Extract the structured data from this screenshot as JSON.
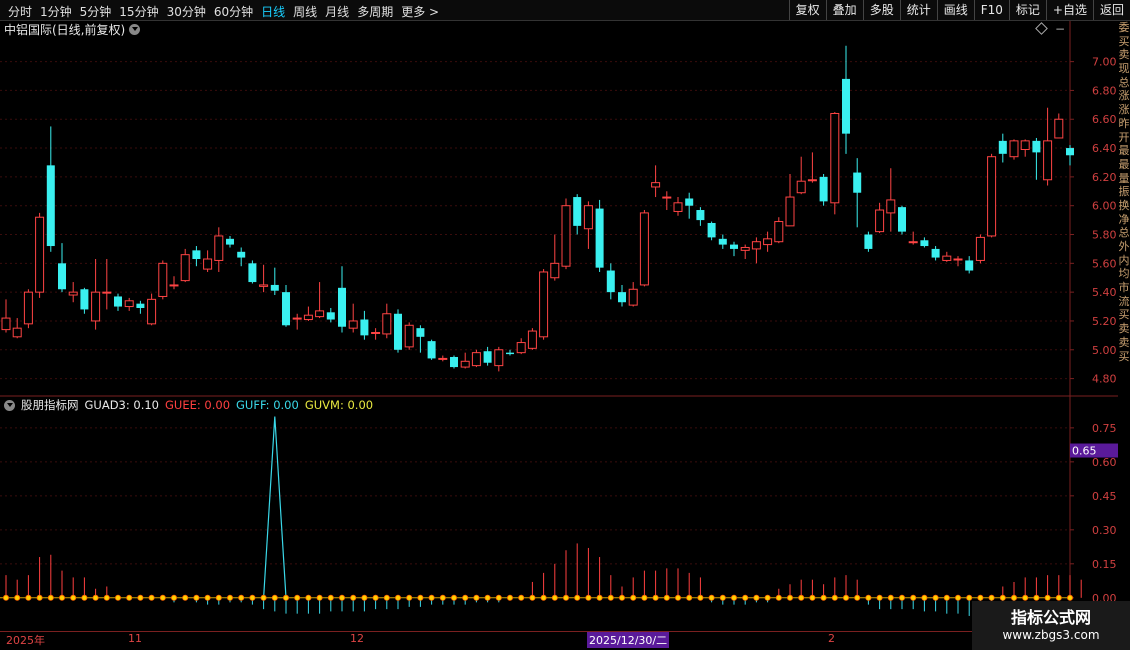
{
  "toolbar": {
    "left_items": [
      "分时",
      "1分钟",
      "5分钟",
      "15分钟",
      "30分钟",
      "60分钟",
      "日线",
      "周线",
      "月线",
      "多周期",
      "更多 >"
    ],
    "active_index": 6,
    "right_items": [
      "复权",
      "叠加",
      "多股",
      "统计",
      "画线",
      "F10",
      "标记",
      "+自选",
      "返回"
    ]
  },
  "chart_title": "中铝国际(日线,前复权)",
  "price_axis": {
    "ticks": [
      "7.00",
      "6.80",
      "6.60",
      "6.40",
      "6.20",
      "6.00",
      "5.80",
      "5.60",
      "5.40",
      "5.20",
      "5.00",
      "4.80"
    ],
    "min": 4.7,
    "max": 7.15
  },
  "indicator": {
    "name": "股朋指标网",
    "params": [
      {
        "label": "GUAD3: 0.10",
        "color": "#e8e8e8"
      },
      {
        "label": "GUEE: 0.00",
        "color": "#ff4040"
      },
      {
        "label": "GUFF: 0.00",
        "color": "#3ad8e8"
      },
      {
        "label": "GUVM: 0.00",
        "color": "#e8e840"
      }
    ],
    "axis_ticks": [
      "0.75",
      "0.60",
      "0.45",
      "0.30",
      "0.15",
      "0.00"
    ],
    "current_value": "0.65"
  },
  "date_axis": {
    "labels": [
      "2025年",
      "11",
      "12",
      "2"
    ],
    "current": "2025/12/30/二"
  },
  "right_strip": "委买卖现总涨涨昨开最最量振换净总外内均市流买卖卖买",
  "watermark": {
    "line1": "指标公式网",
    "line2": "www.zbgs3.com"
  },
  "colors": {
    "up": "#ff4444",
    "down": "#3af0f0",
    "grid": "#3a0c0c"
  },
  "chart_data": {
    "type": "candlestick",
    "ylim": [
      4.7,
      7.15
    ],
    "ohlc": [
      [
        5.14,
        5.22,
        5.35,
        5.12
      ],
      [
        5.09,
        5.15,
        5.22,
        5.08
      ],
      [
        5.18,
        5.4,
        5.42,
        5.15
      ],
      [
        5.4,
        5.92,
        5.95,
        5.36
      ],
      [
        6.28,
        5.72,
        6.55,
        5.68
      ],
      [
        5.6,
        5.42,
        5.74,
        5.4
      ],
      [
        5.38,
        5.4,
        5.47,
        5.33
      ],
      [
        5.42,
        5.28,
        5.43,
        5.25
      ],
      [
        5.2,
        5.4,
        5.63,
        5.14
      ],
      [
        5.4,
        5.4,
        5.63,
        5.28
      ],
      [
        5.37,
        5.3,
        5.39,
        5.27
      ],
      [
        5.3,
        5.34,
        5.36,
        5.27
      ],
      [
        5.32,
        5.29,
        5.34,
        5.25
      ],
      [
        5.18,
        5.35,
        5.39,
        5.17
      ],
      [
        5.37,
        5.6,
        5.62,
        5.35
      ],
      [
        5.45,
        5.45,
        5.51,
        5.42
      ],
      [
        5.48,
        5.66,
        5.7,
        5.47
      ],
      [
        5.69,
        5.63,
        5.72,
        5.58
      ],
      [
        5.56,
        5.63,
        5.69,
        5.54
      ],
      [
        5.62,
        5.79,
        5.85,
        5.54
      ],
      [
        5.77,
        5.73,
        5.79,
        5.71
      ],
      [
        5.68,
        5.64,
        5.71,
        5.58
      ],
      [
        5.6,
        5.47,
        5.62,
        5.46
      ],
      [
        5.44,
        5.45,
        5.59,
        5.4
      ],
      [
        5.45,
        5.41,
        5.57,
        5.38
      ],
      [
        5.4,
        5.17,
        5.45,
        5.16
      ],
      [
        5.22,
        5.22,
        5.25,
        5.14
      ],
      [
        5.21,
        5.24,
        5.3,
        5.2
      ],
      [
        5.23,
        5.27,
        5.47,
        5.22
      ],
      [
        5.26,
        5.21,
        5.29,
        5.19
      ],
      [
        5.43,
        5.16,
        5.58,
        5.12
      ],
      [
        5.15,
        5.2,
        5.32,
        5.12
      ],
      [
        5.21,
        5.1,
        5.27,
        5.07
      ],
      [
        5.12,
        5.12,
        5.15,
        5.07
      ],
      [
        5.11,
        5.25,
        5.32,
        5.08
      ],
      [
        5.25,
        5.0,
        5.28,
        4.98
      ],
      [
        5.02,
        5.17,
        5.19,
        5.0
      ],
      [
        5.15,
        5.09,
        5.17,
        4.98
      ],
      [
        5.06,
        4.94,
        5.07,
        4.93
      ],
      [
        4.94,
        4.94,
        4.96,
        4.92
      ],
      [
        4.95,
        4.88,
        4.96,
        4.87
      ],
      [
        4.88,
        4.92,
        4.98,
        4.87
      ],
      [
        4.89,
        4.98,
        5.0,
        4.88
      ],
      [
        4.99,
        4.91,
        5.02,
        4.89
      ],
      [
        4.89,
        5.0,
        5.02,
        4.85
      ],
      [
        4.98,
        4.97,
        5.0,
        4.96
      ],
      [
        4.98,
        5.05,
        5.08,
        4.97
      ],
      [
        5.01,
        5.13,
        5.15,
        5.0
      ],
      [
        5.09,
        5.54,
        5.56,
        5.07
      ],
      [
        5.5,
        5.6,
        5.8,
        5.48
      ],
      [
        5.58,
        6.0,
        6.05,
        5.56
      ],
      [
        6.06,
        5.86,
        6.08,
        5.8
      ],
      [
        5.84,
        6.0,
        6.03,
        5.7
      ],
      [
        5.98,
        5.57,
        6.04,
        5.54
      ],
      [
        5.55,
        5.4,
        5.6,
        5.35
      ],
      [
        5.4,
        5.33,
        5.45,
        5.3
      ],
      [
        5.31,
        5.42,
        5.47,
        5.3
      ],
      [
        5.45,
        5.95,
        5.97,
        5.44
      ],
      [
        6.13,
        6.16,
        6.28,
        6.06
      ],
      [
        6.06,
        6.06,
        6.1,
        5.97
      ],
      [
        5.96,
        6.02,
        6.06,
        5.93
      ],
      [
        6.05,
        6.0,
        6.09,
        5.91
      ],
      [
        5.97,
        5.9,
        5.99,
        5.86
      ],
      [
        5.88,
        5.78,
        5.89,
        5.76
      ],
      [
        5.77,
        5.73,
        5.8,
        5.7
      ],
      [
        5.73,
        5.7,
        5.75,
        5.65
      ],
      [
        5.69,
        5.71,
        5.73,
        5.63
      ],
      [
        5.7,
        5.75,
        5.78,
        5.6
      ],
      [
        5.73,
        5.77,
        5.82,
        5.68
      ],
      [
        5.75,
        5.89,
        5.92,
        5.74
      ],
      [
        5.86,
        6.06,
        6.22,
        5.86
      ],
      [
        6.09,
        6.17,
        6.34,
        6.08
      ],
      [
        6.18,
        6.18,
        6.37,
        6.16
      ],
      [
        6.2,
        6.03,
        6.22,
        6.0
      ],
      [
        6.02,
        6.64,
        6.65,
        5.94
      ],
      [
        6.88,
        6.5,
        7.11,
        6.36
      ],
      [
        6.23,
        6.09,
        6.33,
        5.85
      ],
      [
        5.8,
        5.7,
        5.82,
        5.68
      ],
      [
        5.82,
        5.97,
        6.02,
        5.81
      ],
      [
        5.95,
        6.04,
        6.26,
        5.82
      ],
      [
        5.99,
        5.82,
        6.0,
        5.8
      ],
      [
        5.75,
        5.75,
        5.82,
        5.73
      ],
      [
        5.76,
        5.72,
        5.78,
        5.71
      ],
      [
        5.7,
        5.64,
        5.72,
        5.62
      ],
      [
        5.62,
        5.65,
        5.68,
        5.61
      ],
      [
        5.63,
        5.63,
        5.65,
        5.58
      ],
      [
        5.62,
        5.55,
        5.65,
        5.53
      ],
      [
        5.62,
        5.78,
        5.8,
        5.6
      ],
      [
        5.79,
        6.34,
        6.36,
        5.78
      ],
      [
        6.45,
        6.36,
        6.5,
        6.3
      ],
      [
        6.34,
        6.45,
        6.46,
        6.32
      ],
      [
        6.39,
        6.45,
        6.46,
        6.34
      ],
      [
        6.45,
        6.37,
        6.47,
        6.18
      ],
      [
        6.18,
        6.45,
        6.68,
        6.14
      ],
      [
        6.47,
        6.6,
        6.64,
        6.5
      ],
      [
        6.4,
        6.35,
        6.42,
        6.28
      ]
    ],
    "guee": [
      0.1,
      0.08,
      0.1,
      0.18,
      0.19,
      0.12,
      0.09,
      0.09,
      0.04,
      0.05,
      0,
      0,
      0,
      0,
      0,
      0,
      0,
      0,
      0,
      0,
      0,
      0,
      0,
      0,
      0,
      0,
      0,
      0,
      0,
      0,
      0,
      0,
      0,
      0,
      0,
      0,
      0,
      0,
      0,
      0,
      0,
      0,
      0,
      0,
      0,
      0,
      0,
      0.07,
      0.11,
      0.15,
      0.21,
      0.24,
      0.22,
      0.18,
      0.1,
      0.05,
      0.09,
      0.12,
      0.12,
      0.13,
      0.13,
      0.11,
      0.09,
      0,
      0,
      0,
      0,
      0,
      0,
      0.04,
      0.06,
      0.08,
      0.08,
      0.06,
      0.09,
      0.1,
      0.08,
      0,
      0,
      0,
      0,
      0,
      0,
      0,
      0,
      0,
      0,
      0,
      0,
      0.05,
      0.07,
      0.09,
      0.09,
      0.1,
      0.1,
      0.1,
      0.08
    ],
    "guff": [
      0,
      0,
      0,
      0,
      0,
      0,
      0,
      0,
      0,
      0,
      0,
      0,
      0,
      -0.01,
      -0.01,
      -0.02,
      -0.01,
      -0.02,
      -0.03,
      -0.03,
      -0.02,
      -0.02,
      -0.03,
      -0.05,
      -0.06,
      -0.07,
      -0.07,
      -0.07,
      -0.07,
      -0.06,
      -0.06,
      -0.06,
      -0.06,
      -0.05,
      -0.05,
      -0.05,
      -0.04,
      -0.04,
      -0.03,
      -0.03,
      -0.03,
      -0.03,
      -0.02,
      -0.02,
      -0.02,
      -0.01,
      -0.01,
      0,
      0,
      0,
      0,
      0,
      0,
      0,
      0,
      0,
      0,
      0,
      0,
      0,
      0,
      0,
      0,
      -0.02,
      -0.03,
      -0.03,
      -0.03,
      -0.02,
      -0.02,
      0,
      0,
      0,
      0,
      0,
      0,
      0,
      -0.01,
      -0.03,
      -0.05,
      -0.05,
      -0.05,
      -0.05,
      -0.06,
      -0.06,
      -0.07,
      -0.07,
      -0.08,
      -0.08,
      -0.07,
      -0.05,
      -0.02,
      0,
      0,
      0,
      0,
      0,
      0
    ],
    "guad3_spike_index": 24,
    "guad3_spike_value": 0.8,
    "ind_ylim": [
      -0.12,
      0.82
    ]
  }
}
